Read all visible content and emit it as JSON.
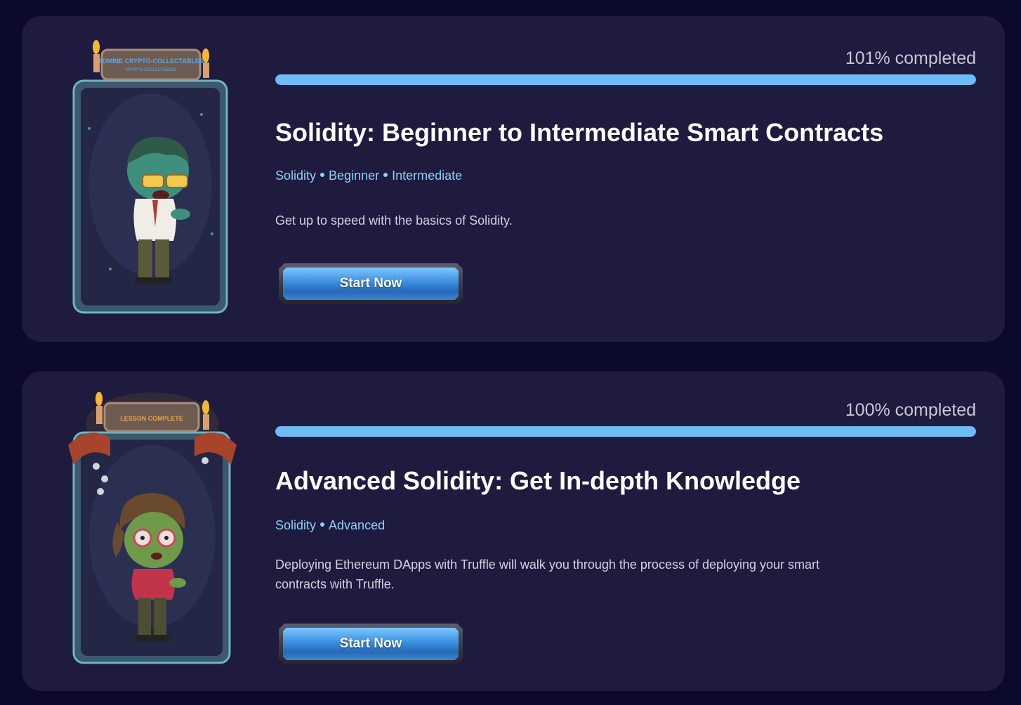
{
  "colors": {
    "page_background": "#0c0a2b",
    "card_background": "#1e1b3f",
    "progress_fill": "#6dbcf7",
    "tag_color": "#8fd0f7",
    "button_blue": "#3b8fe0"
  },
  "courses": [
    {
      "progress_label": "101% completed",
      "progress_fraction": 1.0,
      "title": "Solidity: Beginner to Intermediate Smart Contracts",
      "tags": [
        "Solidity",
        "Beginner",
        "Intermediate"
      ],
      "description": "Get up to speed with the basics of Solidity.",
      "button_label": "Start Now",
      "badge_text": "ZOMBIE CRYPTO-COLLECTABLES",
      "image": "zombie-card-boy-icon"
    },
    {
      "progress_label": "100% completed",
      "progress_fraction": 1.0,
      "title": "Advanced Solidity: Get In-depth Knowledge",
      "tags": [
        "Solidity",
        "Advanced"
      ],
      "description": "Deploying Ethereum DApps with Truffle will walk you through the process of deploying your smart contracts with Truffle.",
      "button_label": "Start Now",
      "badge_text": "LESSON COMPLETE",
      "image": "zombie-card-girl-icon"
    }
  ]
}
